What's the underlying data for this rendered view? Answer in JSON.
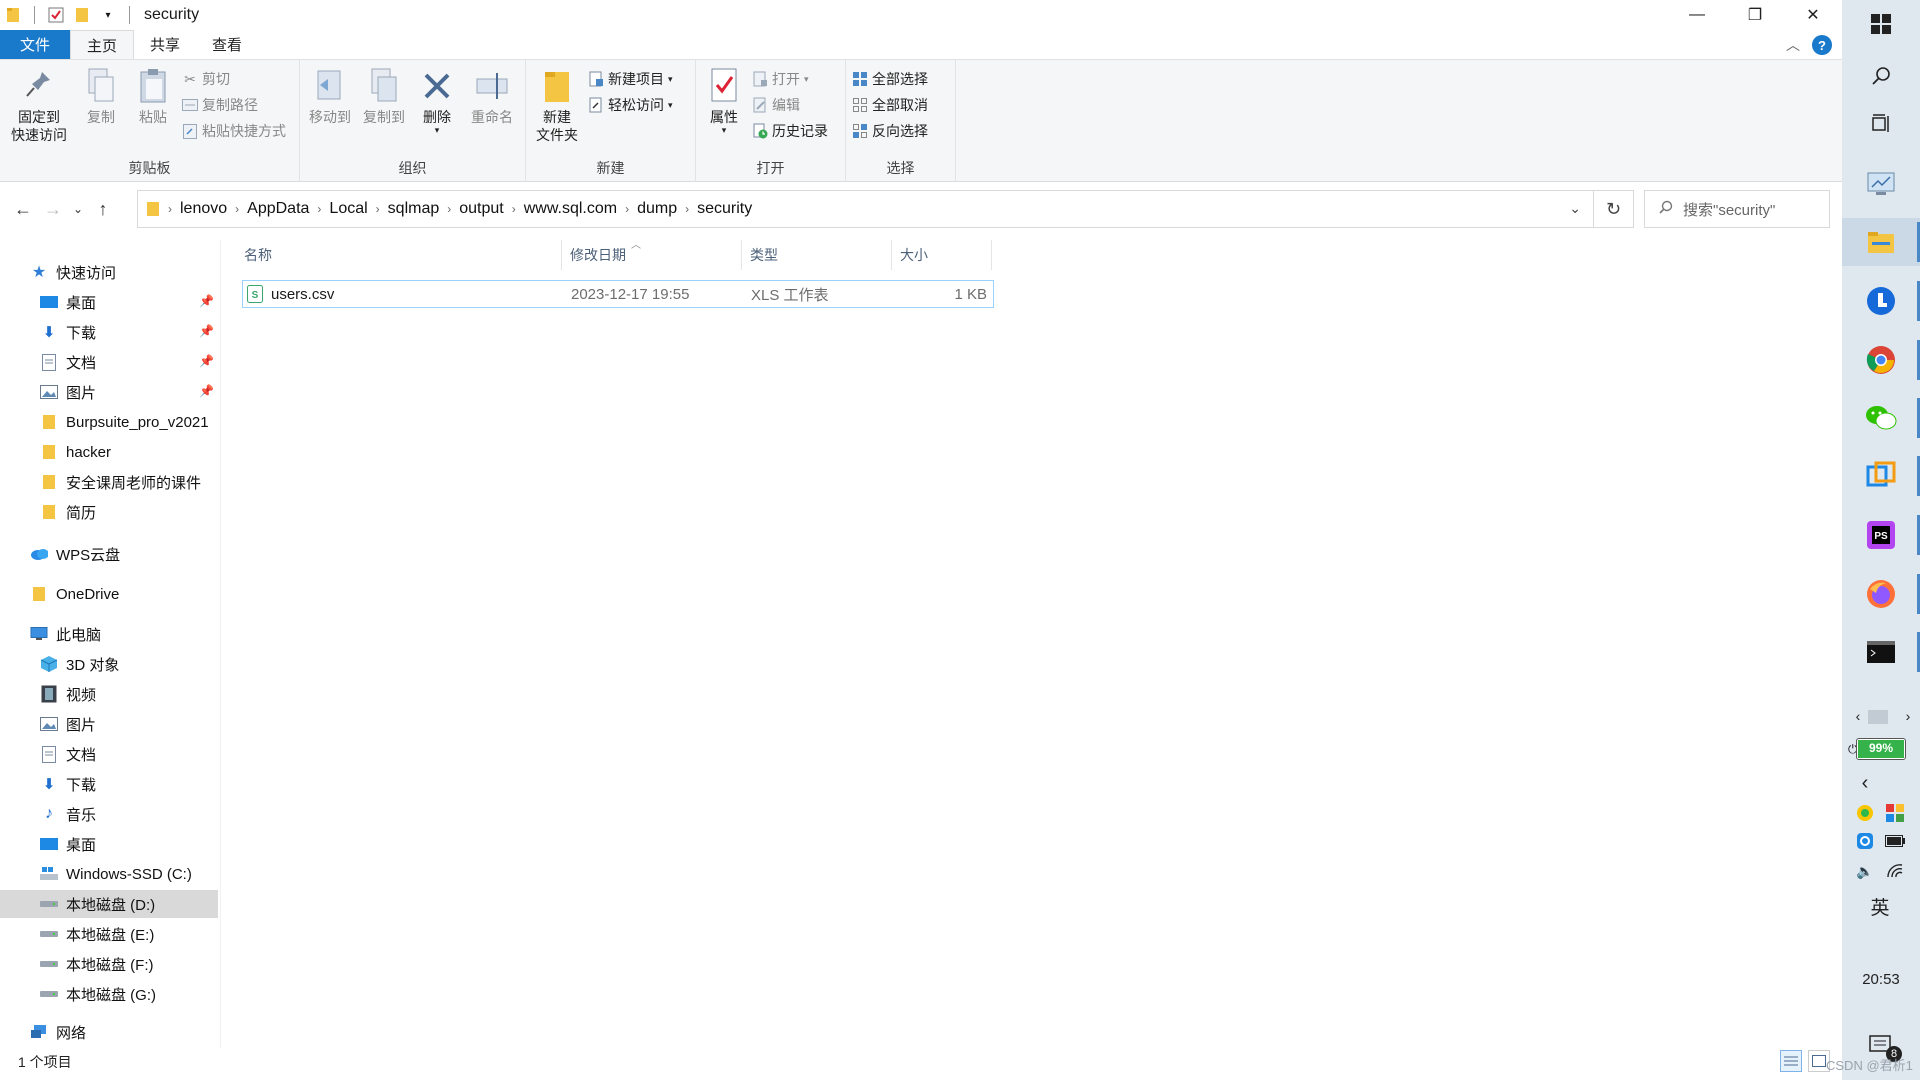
{
  "window": {
    "title": "security",
    "controls": {
      "minimize": "—",
      "maximize": "❐",
      "close": "✕"
    }
  },
  "ribbon_tabs": [
    "文件",
    "主页",
    "共享",
    "查看"
  ],
  "ribbon": {
    "clipboard": {
      "label": "剪贴板",
      "pin": "固定到\n快速访问",
      "pin_l1": "固定到",
      "pin_l2": "快速访问",
      "copy": "复制",
      "paste": "粘贴",
      "cut": "剪切",
      "copy_path": "复制路径",
      "paste_shortcut": "粘贴快捷方式"
    },
    "organize": {
      "label": "组织",
      "move_to": "移动到",
      "copy_to": "复制到",
      "delete": "删除",
      "rename": "重命名"
    },
    "new": {
      "label": "新建",
      "new_folder_l1": "新建",
      "new_folder_l2": "文件夹",
      "new_item": "新建项目",
      "easy_access": "轻松访问"
    },
    "open": {
      "label": "打开",
      "properties": "属性",
      "open": "打开",
      "edit": "编辑",
      "history": "历史记录"
    },
    "select": {
      "label": "选择",
      "select_all": "全部选择",
      "select_none": "全部取消",
      "invert": "反向选择"
    }
  },
  "address": {
    "crumbs": [
      "lenovo",
      "AppData",
      "Local",
      "sqlmap",
      "output",
      "www.sql.com",
      "dump",
      "security"
    ],
    "search_placeholder": "搜索\"security\""
  },
  "nav": {
    "quick_access": "快速访问",
    "qa_items": [
      "桌面",
      "下载",
      "文档",
      "图片",
      "Burpsuite_pro_v2021",
      "hacker",
      "安全课周老师的课件",
      "简历"
    ],
    "wps": "WPS云盘",
    "onedrive": "OneDrive",
    "this_pc": "此电脑",
    "pc_items": [
      "3D 对象",
      "视频",
      "图片",
      "文档",
      "下载",
      "音乐",
      "桌面",
      "Windows-SSD (C:)",
      "本地磁盘 (D:)",
      "本地磁盘 (E:)",
      "本地磁盘 (F:)",
      "本地磁盘 (G:)"
    ],
    "network": "网络"
  },
  "columns": [
    "名称",
    "修改日期",
    "类型",
    "大小"
  ],
  "files": [
    {
      "name": "users.csv",
      "modified": "2023-12-17 19:55",
      "type": "XLS 工作表",
      "size": "1 KB"
    }
  ],
  "status": {
    "count": "1 个项目"
  },
  "taskbar": {
    "battery": "99%",
    "battery_level": 0.99,
    "ime": "英",
    "time": "20:53",
    "notifications": "8",
    "watermark": "CSDN @君析1"
  },
  "colors": {
    "accent": "#1979ca",
    "ribbon_bg": "#f5f6f7",
    "selected_row_border": "#99d1ff",
    "taskbar_bg": "#dfe7ef"
  }
}
